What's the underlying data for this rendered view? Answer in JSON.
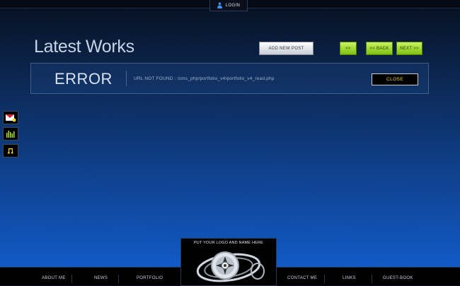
{
  "header": {
    "login_label": "LOGIN"
  },
  "page": {
    "title": "Latest Works"
  },
  "toolbar": {
    "add_post_label": "ADD NEW POST",
    "prev_label": "<<",
    "back_label": "<< BACK",
    "next_label": "NEXT >>"
  },
  "error_panel": {
    "heading": "ERROR",
    "message": "URL NOT FOUND : /cms_php/portfolio_v4/portfolio_v4_read.php",
    "close_label": "CLOSE"
  },
  "sidebar": {
    "icons": [
      "mail-icon",
      "equalizer-icon",
      "music-note-icon"
    ]
  },
  "logo": {
    "text": "PUT YOUR LOGO AND NAME HERE"
  },
  "footer_nav": {
    "about": "ABOUT ME",
    "news": "NEWS",
    "portfolio": "PORTFOLIO",
    "contact": "CONTACT ME",
    "links": "LINKS",
    "guestbook": "GUEST-BOOK"
  },
  "colors": {
    "accent_green": "#9fdd28",
    "close_text": "#f2d530",
    "background_bottom": "#1261d7"
  }
}
